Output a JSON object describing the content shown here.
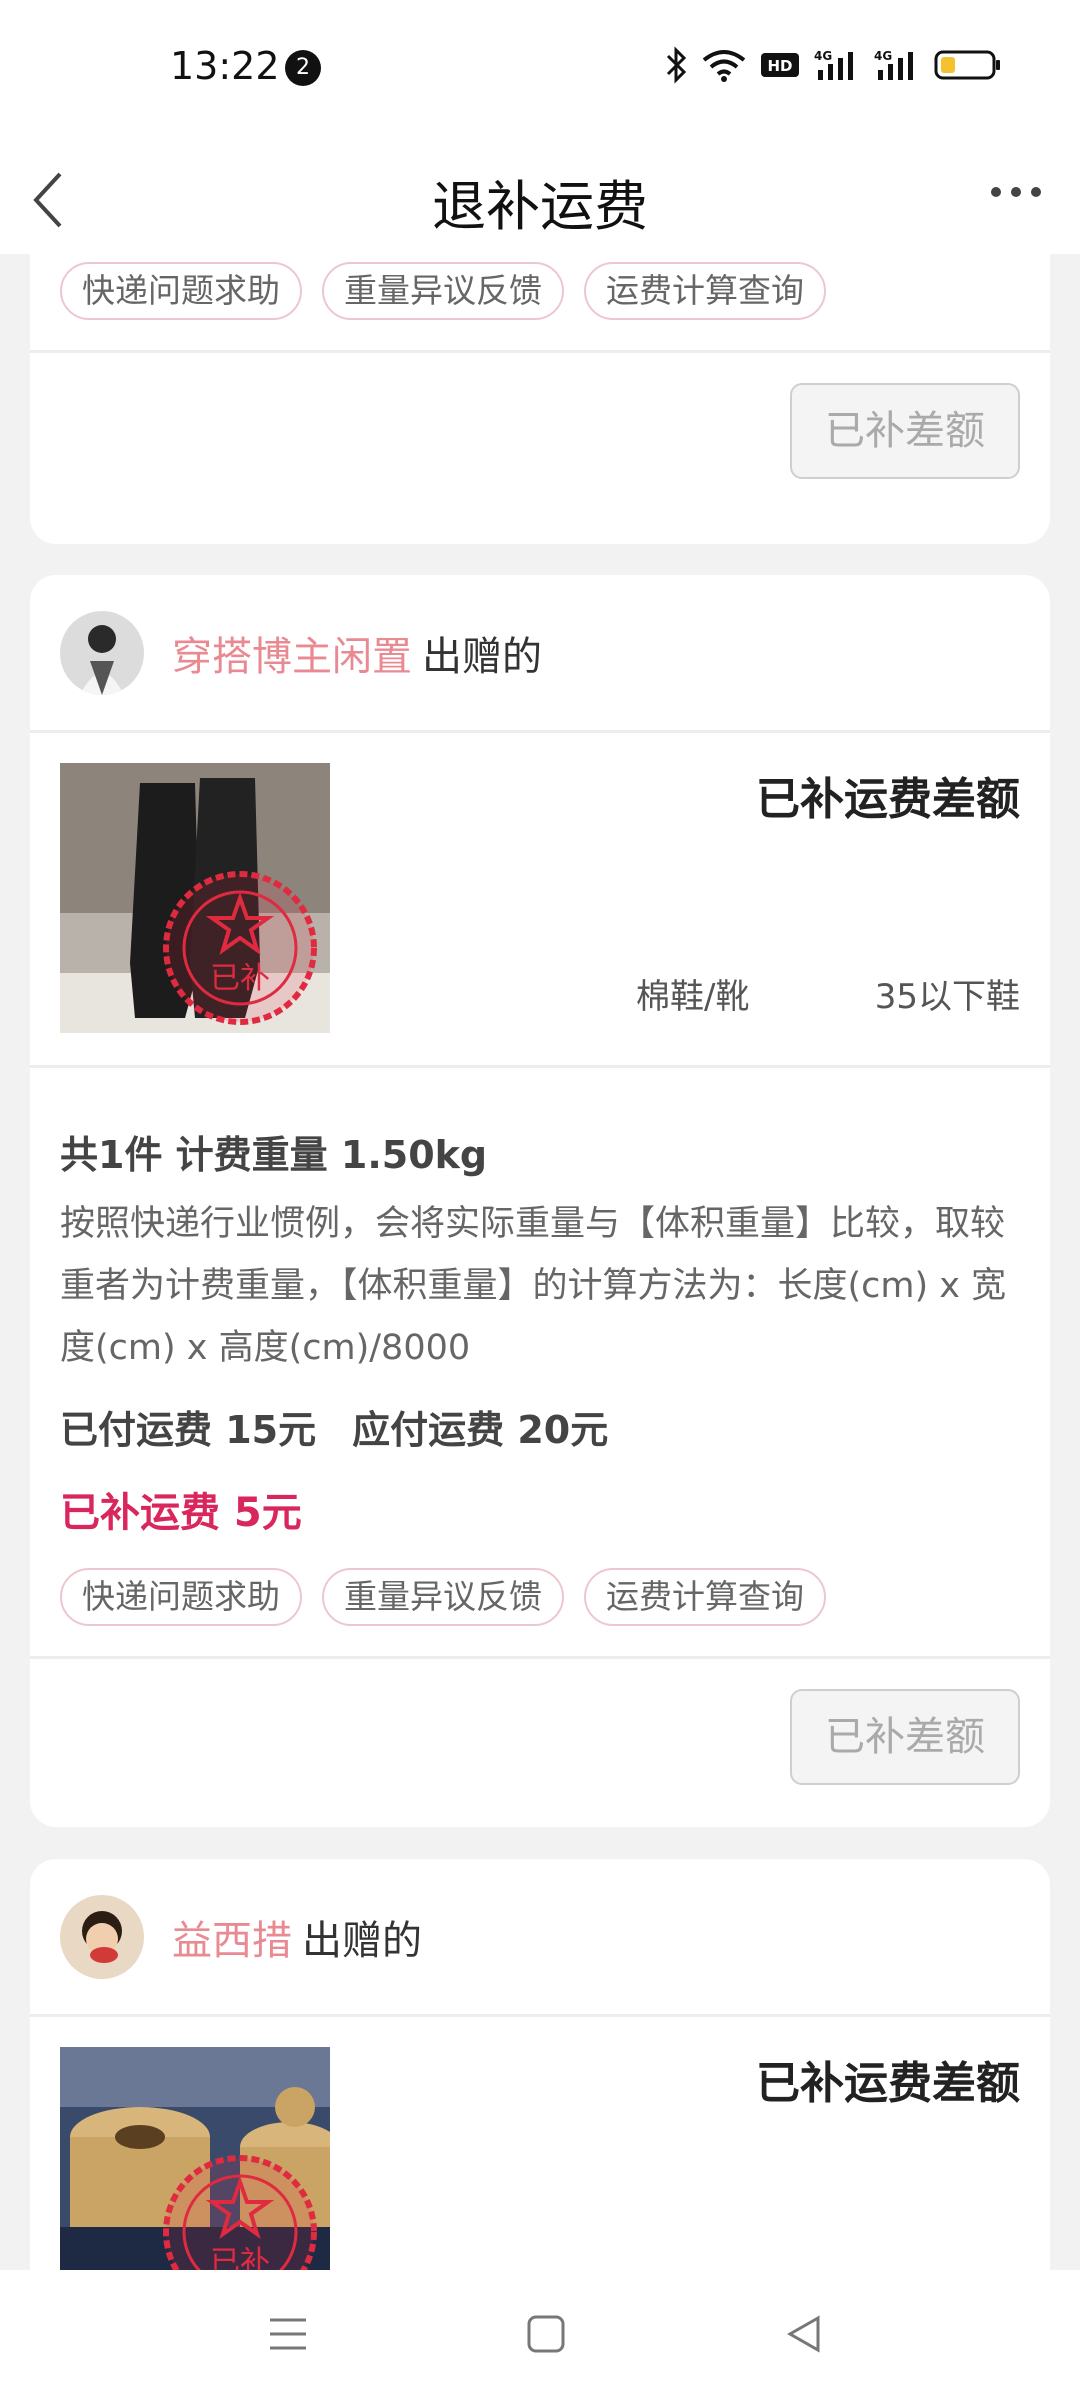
{
  "status_bar": {
    "time": "13:22",
    "notification_count": "2"
  },
  "header": {
    "title": "退补运费"
  },
  "cards": [
    {
      "tags": [
        "快递问题求助",
        "重量异议反馈",
        "运费计算查询"
      ],
      "button_label": "已补差额"
    },
    {
      "seller_name": "穿搭博主闲置",
      "seller_suffix": "出赠的",
      "status_title": "已补运费差额",
      "category": "棉鞋/靴",
      "size": "35以下鞋",
      "stamp_text": "已补",
      "weight_line": "共1件 计费重量 1.50kg",
      "description": "按照快递行业惯例，会将实际重量与【体积重量】比较，取较重者为计费重量，【体积重量】的计算方法为：长度(cm) x 宽度(cm) x 高度(cm)/8000",
      "paid_fee": "已付运费 15元",
      "due_fee": "应付运费 20元",
      "supplement": "已补运费 5元",
      "tags": [
        "快递问题求助",
        "重量异议反馈",
        "运费计算查询"
      ],
      "button_label": "已补差额"
    },
    {
      "seller_name": "益西措",
      "seller_suffix": "出赠的",
      "status_title": "已补运费差额",
      "stamp_text": "已补"
    }
  ],
  "colors": {
    "accent_pink": "#e98a93",
    "supplement_red": "#d9265c",
    "tag_border": "#eec7ce"
  },
  "icons": [
    "back-icon",
    "more-icon",
    "bluetooth-icon",
    "wifi-icon",
    "hd-icon",
    "signal-4g-icon",
    "battery-icon",
    "menu-icon",
    "home-icon",
    "back-triangle-icon"
  ]
}
